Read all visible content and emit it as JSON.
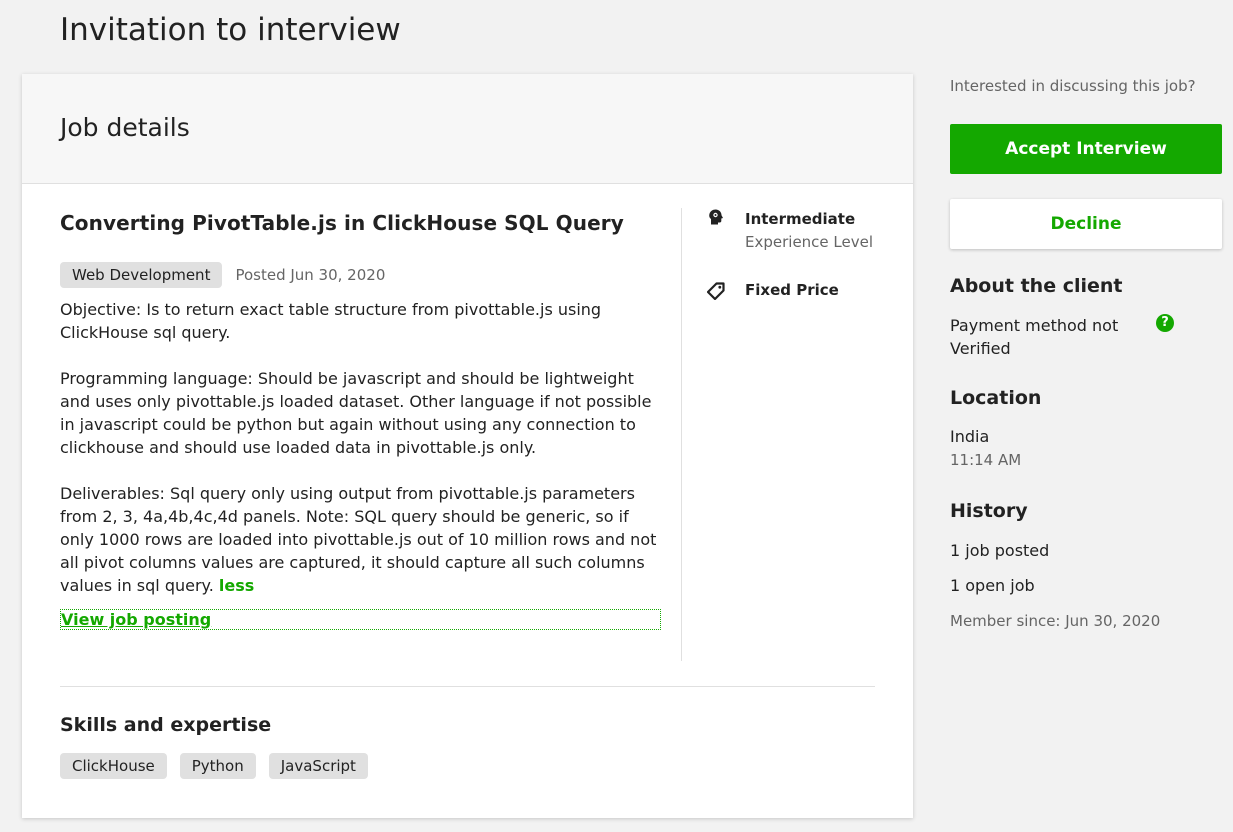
{
  "page": {
    "title": "Invitation to interview"
  },
  "card": {
    "header": "Job details",
    "job_title": "Converting PivotTable.js in ClickHouse SQL Query",
    "category": "Web Development",
    "posted": "Posted Jun 30, 2020",
    "description": [
      "Objective: Is to return exact table structure from pivottable.js using ClickHouse sql query.",
      "Programming language: Should be javascript and should be lightweight and uses only pivottable.js loaded dataset. Other language if not possible in javascript could be python but again without using any connection to clickhouse and should use loaded data in pivottable.js only.",
      "Deliverables: Sql query only using output from pivottable.js parameters from 2, 3, 4a,4b,4c,4d panels. Note: SQL query should be generic, so if only 1000 rows are loaded into pivottable.js out of 10 million rows and not all pivot columns values are captured, it should capture all such columns values in sql query."
    ],
    "less_link": "less",
    "view_posting": "View job posting",
    "experience": {
      "icon": "brain-head-icon",
      "level": "Intermediate",
      "label": "Experience Level"
    },
    "budget": {
      "icon": "price-tag-icon",
      "label": "Fixed Price"
    },
    "skills_title": "Skills and expertise",
    "skills": [
      "ClickHouse",
      "Python",
      "JavaScript"
    ]
  },
  "sidebar": {
    "discuss": "Interested in discussing this job?",
    "accept_label": "Accept Interview",
    "decline_label": "Decline",
    "about_title": "About the client",
    "payment": "Payment method not Verified",
    "payment_help_icon": "question-circle-icon",
    "location_title": "Location",
    "country": "India",
    "local_time": "11:14 AM",
    "history_title": "History",
    "jobs_posted": "1 job posted",
    "open_jobs": "1 open job",
    "member_since": "Member since: Jun 30, 2020"
  },
  "colors": {
    "accent": "#14a800",
    "background": "#f2f2f2",
    "tag_bg": "#e0e0e0",
    "muted_text": "#656565"
  }
}
